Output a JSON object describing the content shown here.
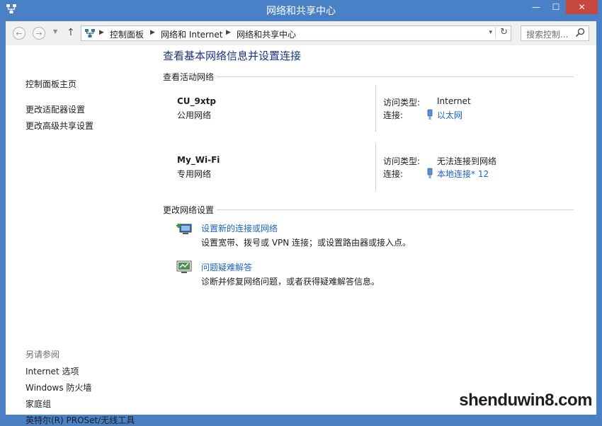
{
  "window": {
    "title": "网络和共享中心",
    "minimize_label": "—",
    "maximize_label": "☐",
    "close_label": "✕"
  },
  "nav": {
    "back_label": "←",
    "forward_label": "→",
    "history_label": "▼",
    "up_label": "↑",
    "breadcrumbs": [
      "控制面板",
      "网络和 Internet",
      "网络和共享中心"
    ],
    "crumb_sep": "▶",
    "dropdown_label": "▾",
    "refresh_label": "↻",
    "search_placeholder": "搜索控制..."
  },
  "sidebar": {
    "home": "控制面板主页",
    "links": [
      "更改适配器设置",
      "更改高级共享设置"
    ],
    "see_also_heading": "另请参阅",
    "see_also": [
      "Internet 选项",
      "Windows 防火墙",
      "家庭组",
      "英特尔(R) PROSet/无线工具"
    ]
  },
  "main": {
    "title": "查看基本网络信息并设置连接",
    "active_heading": "查看活动网络",
    "access_type_label": "访问类型:",
    "connection_label": "连接:",
    "networks": [
      {
        "name": "CU_9xtp",
        "type": "公用网络",
        "access": "Internet",
        "connection": "以太网"
      },
      {
        "name": "My_Wi-Fi",
        "type": "专用网络",
        "access": "无法连接到网络",
        "connection": "本地连接* 12"
      }
    ],
    "change_heading": "更改网络设置",
    "tasks": [
      {
        "link": "设置新的连接或网络",
        "desc": "设置宽带、拨号或 VPN 连接；或设置路由器或接入点。"
      },
      {
        "link": "问题疑难解答",
        "desc": "诊断并修复网络问题，或者获得疑难解答信息。"
      }
    ]
  },
  "watermark": "shenduwin8.com"
}
